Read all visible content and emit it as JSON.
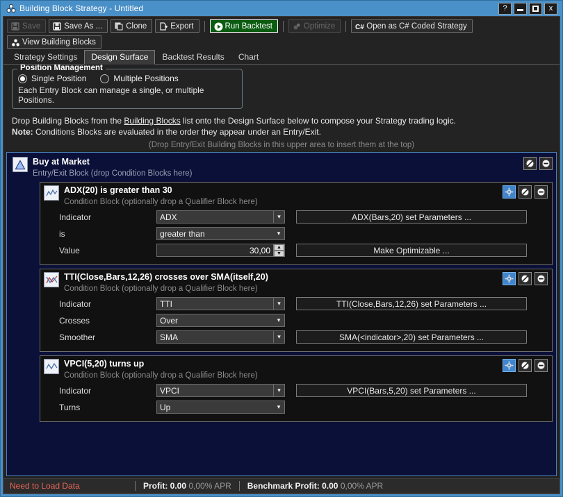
{
  "window": {
    "title": "Building Block Strategy - Untitled",
    "app_icon": "building-blocks-icon",
    "buttons": {
      "help": "?",
      "minimize": "",
      "maximize": "",
      "close": "x"
    }
  },
  "toolbar": {
    "save": "Save",
    "save_as": "Save As ...",
    "clone": "Clone",
    "export": "Export",
    "run_backtest": "Run Backtest",
    "optimize": "Optimize",
    "open_csharp": "Open as C# Coded Strategy",
    "view_building_blocks": "View Building Blocks"
  },
  "tabs": [
    {
      "label": "Strategy Settings",
      "active": false
    },
    {
      "label": "Design Surface",
      "active": true
    },
    {
      "label": "Backtest Results",
      "active": false
    },
    {
      "label": "Chart",
      "active": false
    }
  ],
  "position_management": {
    "title": "Position Management",
    "option_single": "Single Position",
    "option_multiple": "Multiple Positions",
    "note": "Each Entry Block can manage a single, or multiple Positions."
  },
  "instructions": {
    "line1_a": "Drop Building Blocks from the ",
    "line1_link": "Building Blocks",
    "line1_b": " list onto the Design Surface below to compose your Strategy trading logic.",
    "line2_label": "Note:",
    "line2_text": " Conditions Blocks are evaluated in the order they appear under an Entry/Exit.",
    "drop_hint": "(Drop Entry/Exit Building Blocks in this upper area to insert them at the top)"
  },
  "entry_block": {
    "icon": "up-triangle-icon",
    "title": "Buy at Market",
    "subtitle": "Entry/Exit Block (drop Condition Blocks here)",
    "buttons": [
      {
        "name": "disable-block-button",
        "glyph": "no-entry-icon"
      },
      {
        "name": "remove-block-button",
        "glyph": "minus-circle-icon"
      }
    ]
  },
  "condition_blocks": [
    {
      "icon": "waveform-icon",
      "title": "ADX(20) is greater than 30",
      "subtitle": "Condition Block (optionally drop a Qualifier Block here)",
      "buttons": [
        {
          "name": "settings-button",
          "glyph": "gear-icon",
          "selected": true
        },
        {
          "name": "disable-block-button",
          "glyph": "no-entry-icon",
          "selected": false
        },
        {
          "name": "remove-block-button",
          "glyph": "minus-circle-icon",
          "selected": false
        }
      ],
      "rows": [
        {
          "label": "Indicator",
          "control": "combo",
          "value": "ADX",
          "action": "ADX(Bars,20) set Parameters ..."
        },
        {
          "label": "is",
          "control": "combo",
          "value": "greater than",
          "action": null
        },
        {
          "label": "Value",
          "control": "spinner",
          "value": "30,00",
          "action": "Make Optimizable ..."
        }
      ]
    },
    {
      "icon": "crossing-lines-icon",
      "title": "TTI(Close,Bars,12,26) crosses over SMA(itself,20)",
      "subtitle": "Condition Block (optionally drop a Qualifier Block here)",
      "buttons": [
        {
          "name": "settings-button",
          "glyph": "gear-icon",
          "selected": true
        },
        {
          "name": "disable-block-button",
          "glyph": "no-entry-icon",
          "selected": false
        },
        {
          "name": "remove-block-button",
          "glyph": "minus-circle-icon",
          "selected": false
        }
      ],
      "rows": [
        {
          "label": "Indicator",
          "control": "combo",
          "value": "TTI",
          "action": "TTI(Close,Bars,12,26) set Parameters ..."
        },
        {
          "label": "Crosses",
          "control": "combo",
          "value": "Over",
          "action": null
        },
        {
          "label": "Smoother",
          "control": "combo",
          "value": "SMA",
          "action": "SMA(<indicator>,20) set Parameters ..."
        }
      ]
    },
    {
      "icon": "waveform-icon",
      "title": "VPCI(5,20) turns up",
      "subtitle": "Condition Block (optionally drop a Qualifier Block here)",
      "buttons": [
        {
          "name": "settings-button",
          "glyph": "gear-icon",
          "selected": true
        },
        {
          "name": "disable-block-button",
          "glyph": "no-entry-icon",
          "selected": false
        },
        {
          "name": "remove-block-button",
          "glyph": "minus-circle-icon",
          "selected": false
        }
      ],
      "rows": [
        {
          "label": "Indicator",
          "control": "combo",
          "value": "VPCI",
          "action": "VPCI(Bars,5,20) set Parameters ..."
        },
        {
          "label": "Turns",
          "control": "combo",
          "value": "Up",
          "action": null
        }
      ]
    }
  ],
  "statusbar": {
    "message": "Need to Load Data",
    "profit_label": "Profit:",
    "profit_value": "0.00",
    "profit_apr": "0,00% APR",
    "benchmark_label": "Benchmark Profit:",
    "benchmark_value": "0.00",
    "benchmark_apr": "0,00% APR"
  },
  "colors": {
    "titlebar": "#4a90c8",
    "surface": "#0b1038",
    "accent_green": "#0a5c10",
    "status_red": "#e8645a",
    "selected_blue": "#3f86cf"
  }
}
